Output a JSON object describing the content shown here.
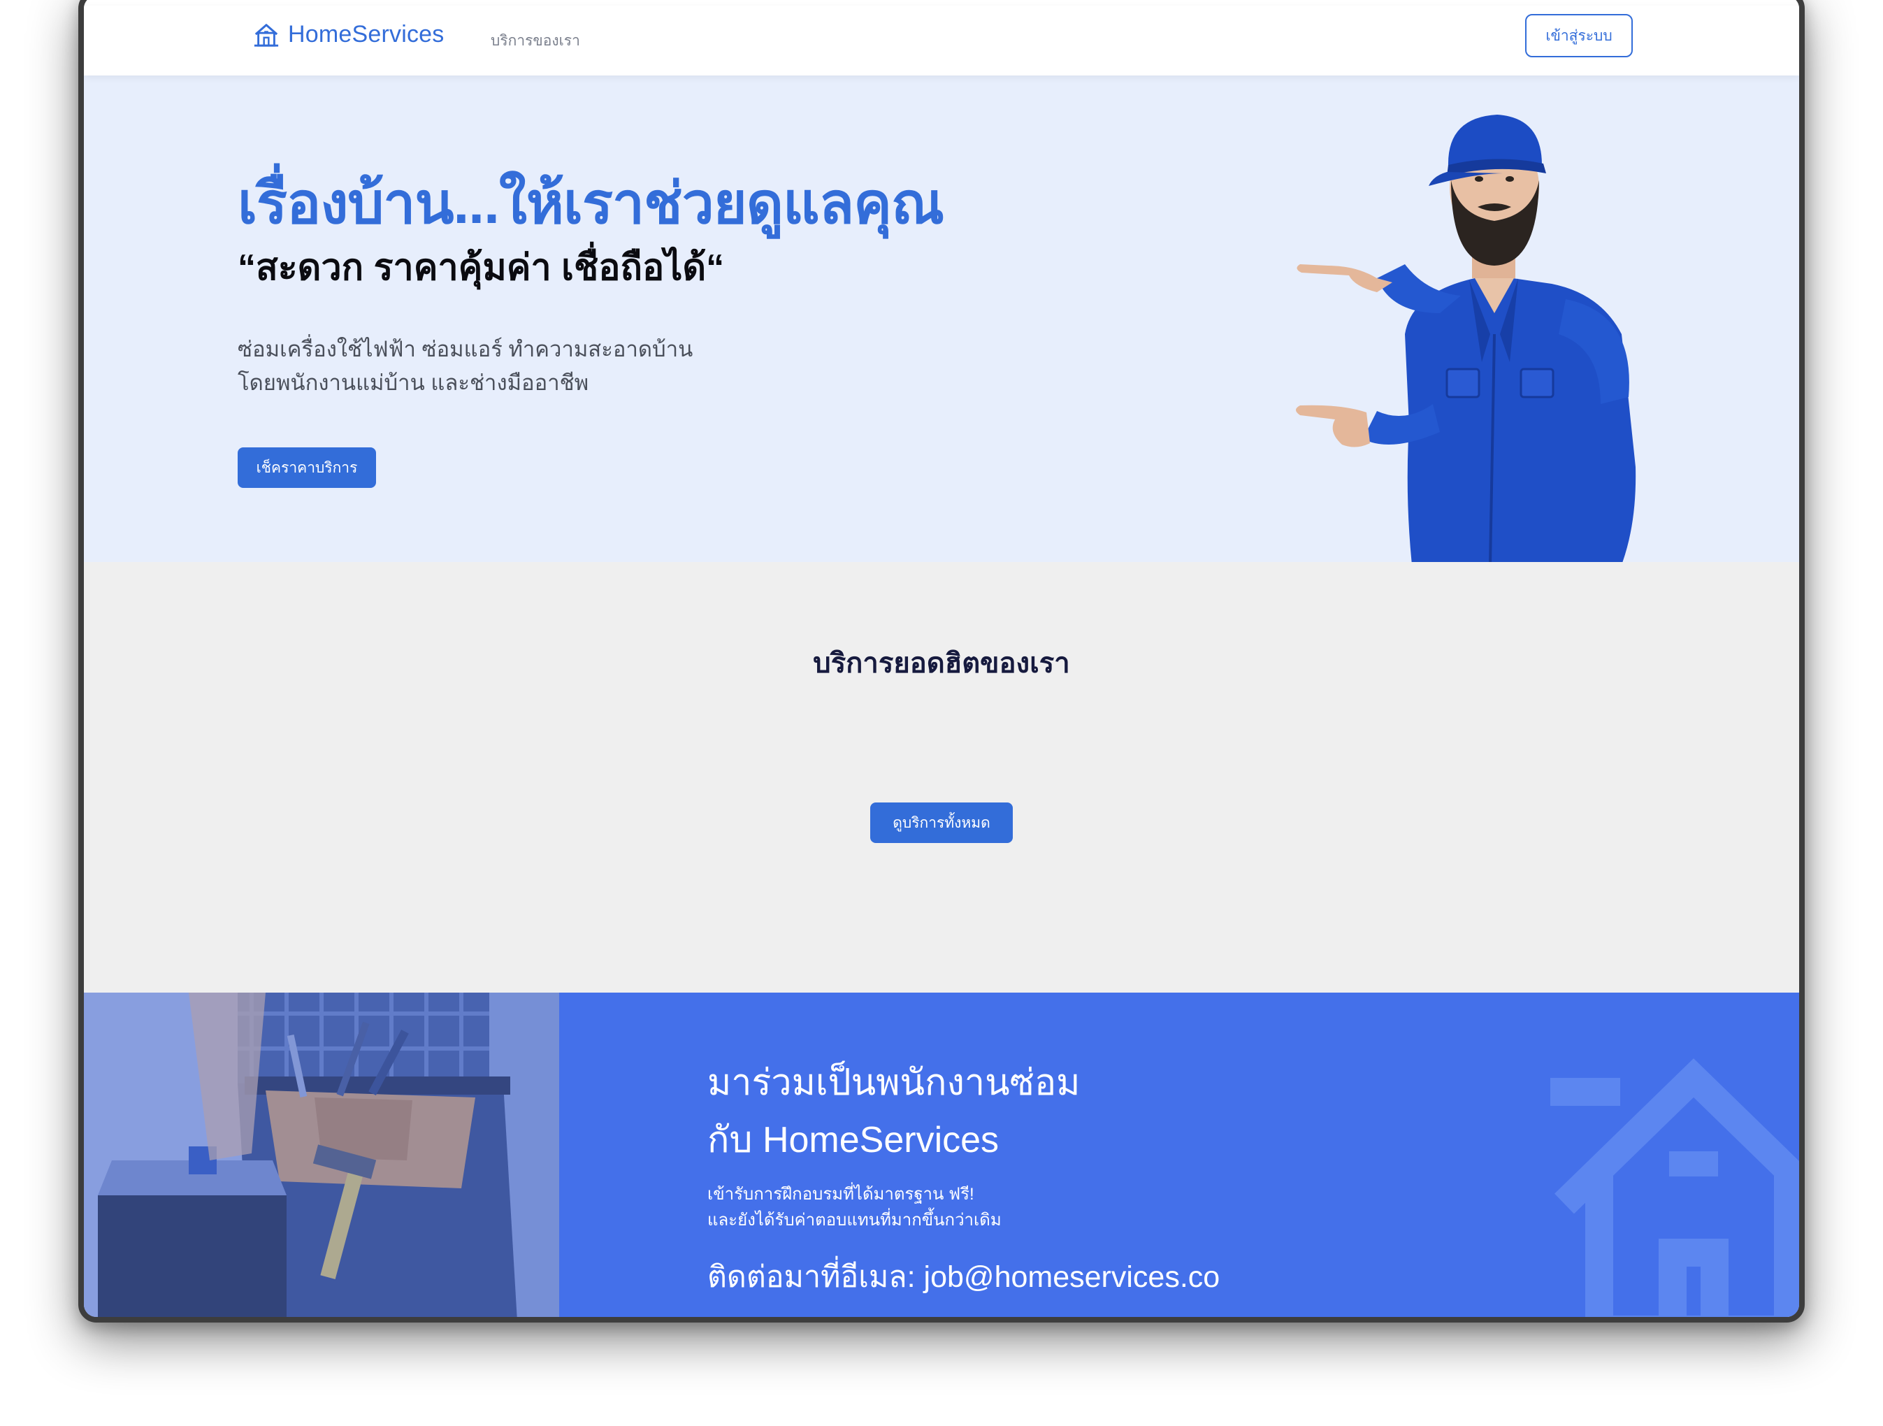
{
  "header": {
    "logo_text": "HomeServices",
    "nav_services": "บริการของเรา",
    "login_label": "เข้าสู่ระบบ"
  },
  "hero": {
    "title": "เรื่องบ้าน...ให้เราช่วยดูแลคุณ",
    "tagline": "“สะดวก ราคาคุ้มค่า เชื่อถือได้“",
    "desc_line1": "ซ่อมเครื่องใช้ไฟฟ้า ซ่อมแอร์ ทำความสะอาดบ้าน",
    "desc_line2": "โดยพนักงานแม่บ้าน และช่างมืออาชีพ",
    "cta_label": "เช็คราคาบริการ"
  },
  "services": {
    "title": "บริการยอดฮิตของเรา",
    "view_all_label": "ดูบริการทั้งหมด"
  },
  "join": {
    "heading_line1": "มาร่วมเป็นพนักงานซ่อม",
    "heading_line2": "กับ HomeServices",
    "sub_line1": "เข้ารับการฝึกอบรมที่ได้มาตรฐาน ฟรี!",
    "sub_line2": "และยังได้รับค่าตอบแทนที่มากขึ้นกว่าเดิม",
    "contact": "ติดต่อมาที่อีเมล: job@homeservices.co"
  },
  "colors": {
    "brand_blue": "#336dd9",
    "hero_bg": "#e7eefc",
    "section_bg": "#efefef",
    "join_bg": "#4470ea",
    "heading_dark": "#161a3e"
  },
  "icons": {
    "logo": "house-icon",
    "hero_image": "repairman-pointing-illustration",
    "join_image": "tool-belt-worker-photo",
    "join_watermark": "house-watermark-icon"
  }
}
